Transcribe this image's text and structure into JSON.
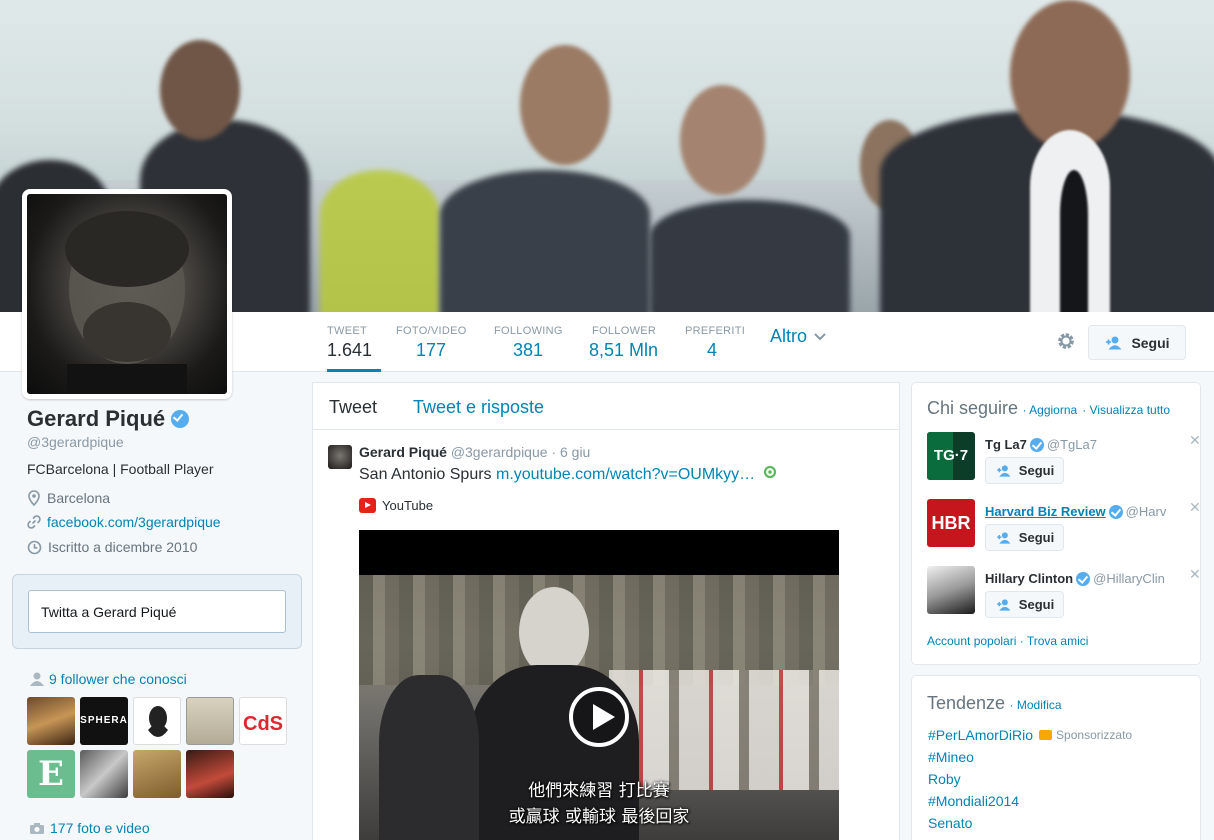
{
  "profile": {
    "name": "Gerard Piqué",
    "handle": "@3gerardpique",
    "bio": "FCBarcelona | Football Player",
    "location": "Barcelona",
    "website": "facebook.com/3gerardpique",
    "joined": "Iscritto a dicembre 2010"
  },
  "nav": {
    "stats": [
      {
        "label": "TWEET",
        "value": "1.641"
      },
      {
        "label": "FOTO/VIDEO",
        "value": "177"
      },
      {
        "label": "FOLLOWING",
        "value": "381"
      },
      {
        "label": "FOLLOWER",
        "value": "8,51 Mln"
      },
      {
        "label": "PREFERITI",
        "value": "4"
      }
    ],
    "more_label": "Altro",
    "follow_label": "Segui"
  },
  "tweetbox": {
    "placeholder": "Twitta a Gerard Piqué"
  },
  "followers_known": {
    "label": "9 follower che conosci"
  },
  "media_link": {
    "label": "177 foto e video"
  },
  "timeline": {
    "tabs": [
      "Tweet",
      "Tweet e risposte"
    ],
    "tweet": {
      "name": "Gerard Piqué",
      "handle": "@3gerardpique",
      "date": "· 6 giu",
      "text": "San Antonio Spurs ",
      "link": "m.youtube.com/watch?v=OUMkyy…",
      "source": "YouTube",
      "subtitle_line1": "他們來練習 打比賽",
      "subtitle_line2": "或贏球 或輸球 最後回家"
    }
  },
  "who_to_follow": {
    "title": "Chi seguire",
    "refresh": "· Aggiorna",
    "view_all": "· Visualizza tutto",
    "accounts": [
      {
        "name": "Tg La7",
        "handle": "@TgLa7",
        "badge": "TG·7",
        "follow": "Segui"
      },
      {
        "name": "Harvard Biz Review",
        "handle": "@Harv",
        "badge": "HBR",
        "follow": "Segui"
      },
      {
        "name": "Hillary Clinton",
        "handle": "@HillaryClin",
        "badge": "",
        "follow": "Segui"
      }
    ],
    "popular": "Account popolari",
    "find_friends": "· Trova amici"
  },
  "trends": {
    "title": "Tendenze",
    "edit": "· Modifica",
    "sponsored": "Sponsorizzato",
    "items": [
      "#PerLAmorDiRio",
      "#Mineo",
      "Roby",
      "#Mondiali2014",
      "Senato"
    ]
  },
  "colors": {
    "accent": "#0084b4",
    "verified": "#55acee"
  }
}
